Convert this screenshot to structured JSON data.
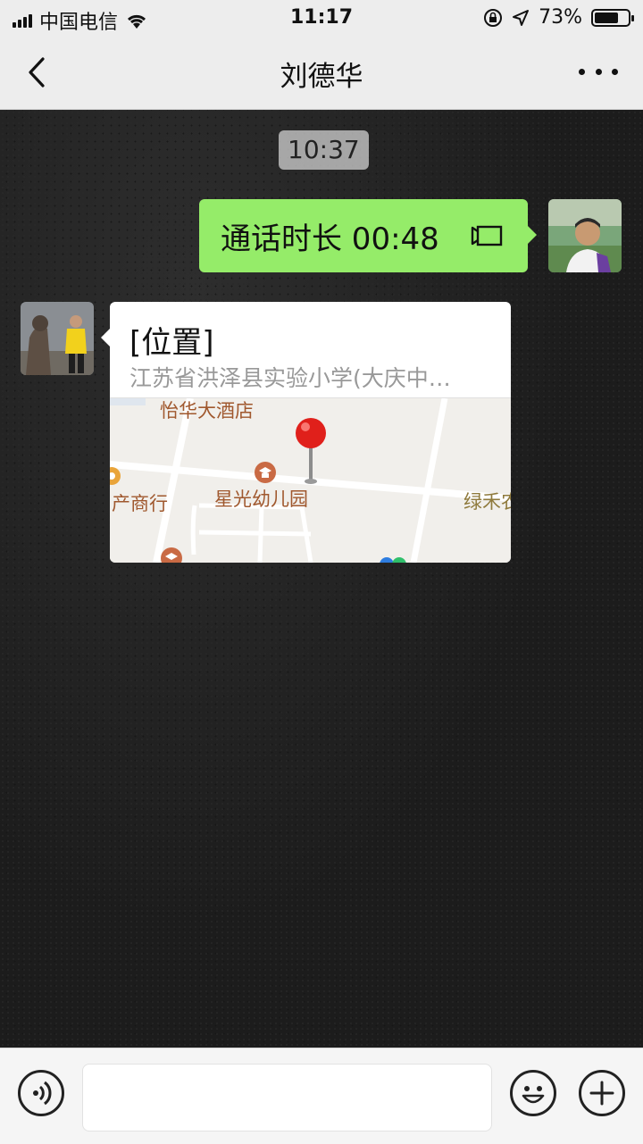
{
  "status_bar": {
    "carrier": "中国电信",
    "time": "11:17",
    "battery_percent": "73%",
    "battery_level": 0.73
  },
  "nav": {
    "title": "刘德华"
  },
  "chat": {
    "timestamp": "10:37",
    "messages": [
      {
        "sender": "me",
        "type": "call",
        "text": "通话时长 00:48"
      },
      {
        "sender": "other",
        "type": "location",
        "title": "[位置]",
        "address": "江苏省洪泽县实验小学(大庆中…",
        "map_labels": {
          "hotel": "怡华大酒店",
          "kindergarten": "星光幼儿园",
          "shop": "产商行",
          "green": "绿禾农"
        }
      }
    ]
  },
  "input": {
    "value": ""
  },
  "colors": {
    "sent_bubble": "#95ec69",
    "received_bubble": "#ffffff",
    "map_pin": "#e0201b"
  }
}
